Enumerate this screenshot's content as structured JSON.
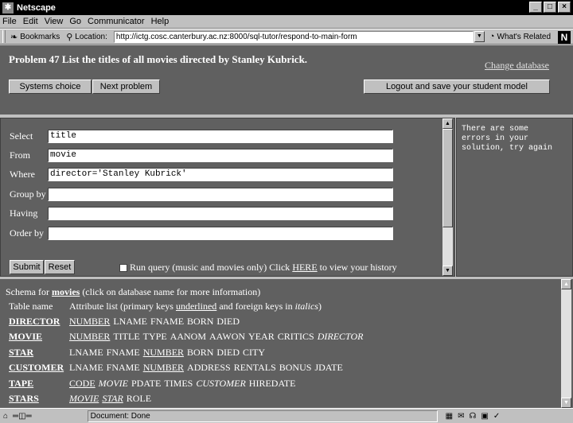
{
  "window": {
    "title": "Netscape"
  },
  "menu": [
    "File",
    "Edit",
    "View",
    "Go",
    "Communicator",
    "Help"
  ],
  "toolbar": {
    "bookmarks_label": "Bookmarks",
    "location_label": "Location:",
    "url": "http://ictg.cosc.canterbury.ac.nz:8000/sql-tutor/respond-to-main-form",
    "whats_related": "What's Related"
  },
  "problem": {
    "title": "Problem 47 List the titles of all movies directed by Stanley Kubrick.",
    "change_database": "Change database",
    "systems_choice": "Systems choice",
    "next_problem": "Next problem",
    "logout": "Logout and save your student model"
  },
  "form": {
    "fields": [
      {
        "label": "Select",
        "value": "title"
      },
      {
        "label": "From",
        "value": "movie"
      },
      {
        "label": "Where",
        "value": "director='Stanley Kubrick'"
      },
      {
        "label": "Group by",
        "value": ""
      },
      {
        "label": "Having",
        "value": ""
      },
      {
        "label": "Order by",
        "value": ""
      }
    ],
    "submit": "Submit",
    "reset": "Reset",
    "run_query_text": "Run query (music and movies only)  Click",
    "here": "HERE",
    "history_text": "to view your history"
  },
  "feedback": {
    "message": "There are some\nerrors in your\nsolution, try again"
  },
  "schema": {
    "prefix": "Schema for",
    "db_name": "movies",
    "suffix": "(click on database name for more information)",
    "col_table": "Table name",
    "col_attrs_a": "Attribute list (primary keys",
    "col_attrs_u": "underlined",
    "col_attrs_b": "and foreign keys in",
    "col_attrs_i": "italics",
    "col_attrs_c": ")",
    "tables": [
      {
        "name": "DIRECTOR",
        "attrs": [
          [
            "NUMBER",
            "pk"
          ],
          [
            "LNAME",
            ""
          ],
          [
            "FNAME",
            ""
          ],
          [
            "BORN",
            ""
          ],
          [
            "DIED",
            ""
          ]
        ]
      },
      {
        "name": "MOVIE",
        "attrs": [
          [
            "NUMBER",
            "pk"
          ],
          [
            "TITLE",
            ""
          ],
          [
            "TYPE",
            ""
          ],
          [
            "AANOM",
            ""
          ],
          [
            "AAWON",
            ""
          ],
          [
            "YEAR",
            ""
          ],
          [
            "CRITICS",
            ""
          ],
          [
            "DIRECTOR",
            "fk"
          ]
        ]
      },
      {
        "name": "STAR",
        "attrs": [
          [
            "LNAME",
            ""
          ],
          [
            "FNAME",
            ""
          ],
          [
            "NUMBER",
            "pk"
          ],
          [
            "BORN",
            ""
          ],
          [
            "DIED",
            ""
          ],
          [
            "CITY",
            ""
          ]
        ]
      },
      {
        "name": "CUSTOMER",
        "attrs": [
          [
            "LNAME",
            ""
          ],
          [
            "FNAME",
            ""
          ],
          [
            "NUMBER",
            "pk"
          ],
          [
            "ADDRESS",
            ""
          ],
          [
            "RENTALS",
            ""
          ],
          [
            "BONUS",
            ""
          ],
          [
            "JDATE",
            ""
          ]
        ]
      },
      {
        "name": "TAPE",
        "attrs": [
          [
            "CODE",
            "pk"
          ],
          [
            "MOVIE",
            "fk"
          ],
          [
            "PDATE",
            ""
          ],
          [
            "TIMES",
            ""
          ],
          [
            "CUSTOMER",
            "fk"
          ],
          [
            "HIREDATE",
            ""
          ]
        ]
      },
      {
        "name": "STARS",
        "attrs": [
          [
            "MOVIE",
            "pkfk"
          ],
          [
            "STAR",
            "pkfk"
          ],
          [
            "ROLE",
            ""
          ]
        ]
      }
    ]
  },
  "status": {
    "text": "Document: Done"
  }
}
